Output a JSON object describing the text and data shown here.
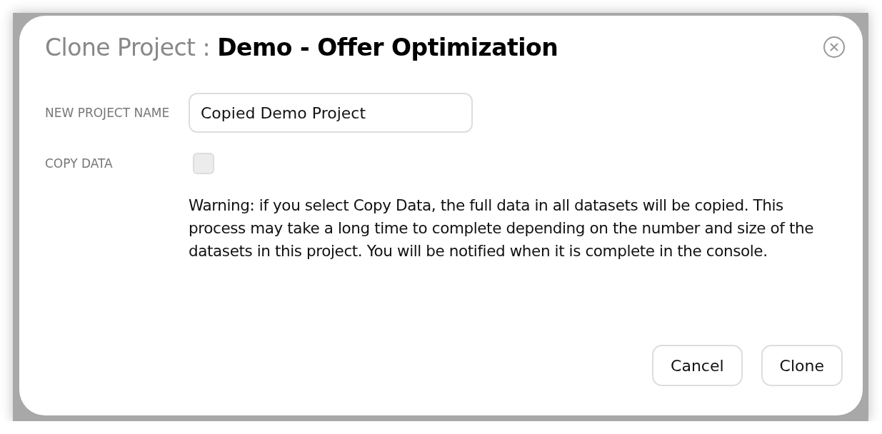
{
  "dialog": {
    "title_prefix": "Clone Project :",
    "title": "Demo - Offer Optimization"
  },
  "fields": [
    {
      "kind": "text",
      "label": "NEW PROJECT NAME",
      "value": "Copied Demo Project"
    },
    {
      "kind": "checkbox",
      "label": "COPY DATA",
      "checked": false
    }
  ],
  "warning": "Warning: if you select Copy Data, the full data in all datasets will be copied. This process may take a long time to complete depending on the number and size of the datasets in this project. You will be notified when it is complete in the console.",
  "buttons": [
    "Cancel",
    "Clone"
  ]
}
